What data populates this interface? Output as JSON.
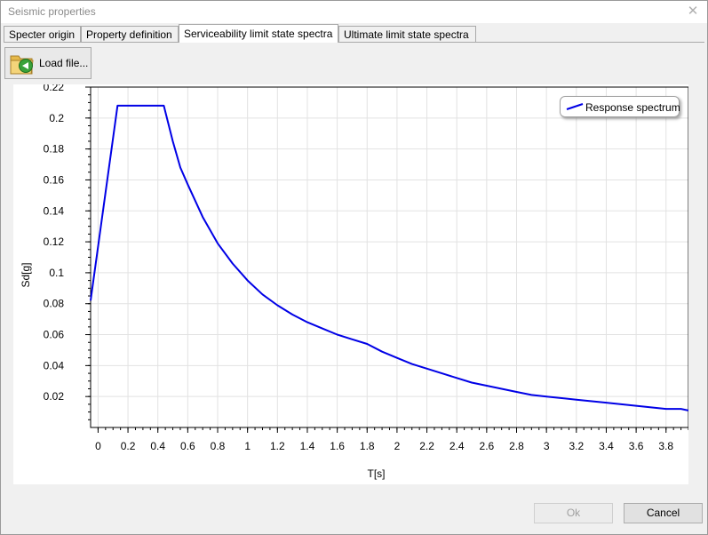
{
  "window": {
    "title": "Seismic properties",
    "close_glyph": "✕"
  },
  "tabs": [
    {
      "label": "Specter origin",
      "active": false
    },
    {
      "label": "Property definition",
      "active": false
    },
    {
      "label": "Serviceability limit state spectra",
      "active": true
    },
    {
      "label": "Ultimate limit state spectra",
      "active": false
    }
  ],
  "toolbar": {
    "load_label": "Load file...",
    "load_icon": "folder-arrow-icon"
  },
  "chart_data": {
    "type": "line",
    "xlabel": "T[s]",
    "ylabel": "Sd[g]",
    "xlim": [
      -0.05,
      3.95
    ],
    "ylim": [
      0.0,
      0.22
    ],
    "x_ticks": [
      "0",
      "0.2",
      "0.4",
      "0.6",
      "0.8",
      "1",
      "1.2",
      "1.4",
      "1.6",
      "1.8",
      "2",
      "2.2",
      "2.4",
      "2.6",
      "2.8",
      "3",
      "3.2",
      "3.4",
      "3.6",
      "3.8"
    ],
    "y_ticks": [
      "0.02",
      "0.04",
      "0.06",
      "0.08",
      "0.1",
      "0.12",
      "0.14",
      "0.16",
      "0.18",
      "0.2",
      "0.22"
    ],
    "legend_position": "top-right",
    "grid": true,
    "series": [
      {
        "name": "Response spectrum",
        "color": "#0000e6",
        "x": [
          -0.05,
          0.13,
          0.2,
          0.3,
          0.4,
          0.44,
          0.5,
          0.55,
          0.6,
          0.7,
          0.8,
          0.9,
          1.0,
          1.1,
          1.2,
          1.3,
          1.4,
          1.5,
          1.6,
          1.7,
          1.8,
          1.9,
          2.0,
          2.1,
          2.2,
          2.3,
          2.4,
          2.5,
          2.6,
          2.7,
          2.8,
          2.9,
          3.0,
          3.2,
          3.4,
          3.6,
          3.7,
          3.8,
          3.9,
          3.95
        ],
        "y": [
          0.082,
          0.208,
          0.208,
          0.208,
          0.208,
          0.208,
          0.185,
          0.168,
          0.157,
          0.136,
          0.119,
          0.106,
          0.095,
          0.086,
          0.079,
          0.073,
          0.068,
          0.064,
          0.06,
          0.057,
          0.054,
          0.049,
          0.045,
          0.041,
          0.038,
          0.035,
          0.032,
          0.029,
          0.027,
          0.025,
          0.023,
          0.021,
          0.02,
          0.018,
          0.016,
          0.014,
          0.013,
          0.012,
          0.012,
          0.011
        ]
      }
    ]
  },
  "buttons": {
    "ok": "Ok",
    "cancel": "Cancel"
  }
}
